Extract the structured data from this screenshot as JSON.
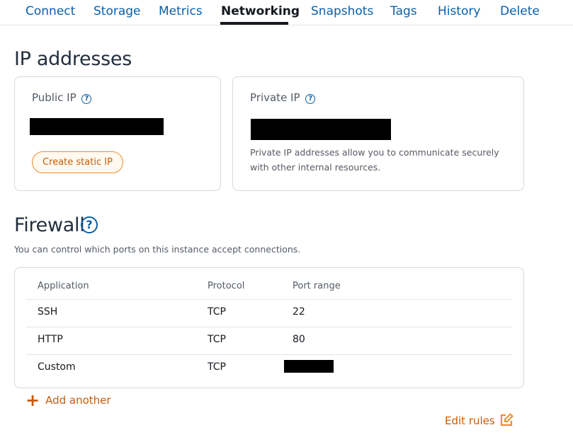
{
  "tabs": [
    {
      "label": "Connect"
    },
    {
      "label": "Storage"
    },
    {
      "label": "Metrics"
    },
    {
      "label": "Networking",
      "active": true
    },
    {
      "label": "Snapshots"
    },
    {
      "label": "Tags"
    },
    {
      "label": "History"
    },
    {
      "label": "Delete"
    }
  ],
  "ip_section": {
    "title": "IP addresses",
    "public": {
      "label": "Public IP",
      "help": "?",
      "button_label": "Create static IP"
    },
    "private": {
      "label": "Private IP",
      "help": "?",
      "description": "Private IP addresses allow you to communicate securely with other internal resources."
    }
  },
  "firewall": {
    "title": "Firewall",
    "help": "?",
    "description": "You can control which ports on this instance accept connections.",
    "columns": [
      "Application",
      "Protocol",
      "Port range"
    ],
    "rows": [
      {
        "application": "SSH",
        "protocol": "TCP",
        "port": "22"
      },
      {
        "application": "HTTP",
        "protocol": "TCP",
        "port": "80"
      },
      {
        "application": "Custom",
        "protocol": "TCP",
        "port": ""
      }
    ],
    "add_label": "Add another",
    "edit_label": "Edit rules"
  },
  "colors": {
    "link": "#0a5fa8",
    "accent": "#ec8f2c",
    "accent_text": "#c75b0b",
    "border": "#d5dbdb"
  },
  "icons": {
    "help": "help-circle-icon",
    "add": "plus-icon",
    "edit": "edit-icon"
  }
}
